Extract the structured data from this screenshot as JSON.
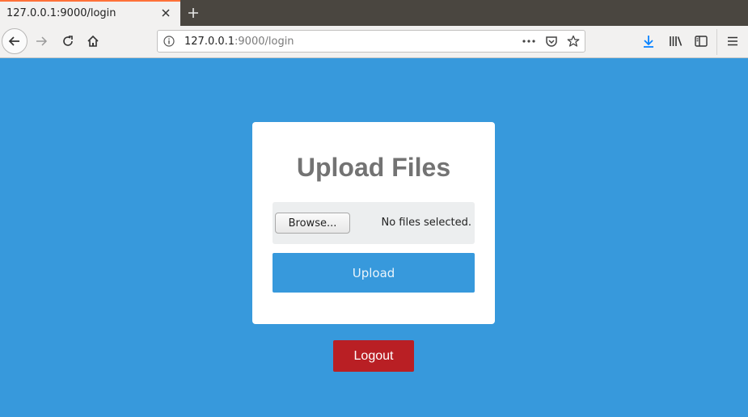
{
  "browser": {
    "tab": {
      "title": "127.0.0.1:9000/login"
    },
    "url": {
      "host": "127.0.0.1",
      "path": ":9000/login"
    },
    "icons": {
      "close": "close-icon",
      "new_tab": "plus-icon",
      "back": "arrow-left-icon",
      "forward": "arrow-right-icon",
      "reload": "reload-icon",
      "home": "home-icon",
      "info": "info-icon",
      "more": "ellipsis-icon",
      "pocket": "pocket-icon",
      "bookmark": "star-icon",
      "download": "download-icon",
      "library": "library-icon",
      "sidebar": "sidebar-icon",
      "menu": "hamburger-icon"
    },
    "colors": {
      "tab_accent": "#ff7139",
      "download_accent": "#0a84ff"
    }
  },
  "page": {
    "background": "#3799dc",
    "card": {
      "title": "Upload Files",
      "file_input": {
        "browse_label": "Browse...",
        "status_text": "No files selected."
      },
      "upload_label": "Upload"
    },
    "logout_label": "Logout",
    "colors": {
      "primary": "#3799dc",
      "danger": "#b91f24",
      "title": "#737373"
    }
  }
}
